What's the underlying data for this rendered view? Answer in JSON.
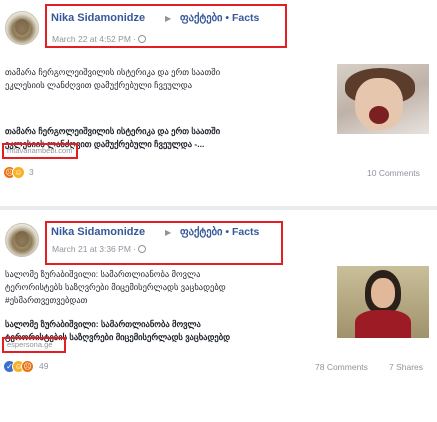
{
  "posts": [
    {
      "author": "Nika Sidamonidze",
      "arrow": "▶",
      "group": "ფაქტები • Facts",
      "time": "March 22 at 4:52 PM ·",
      "text_lines": [
        "თამარა ჩერგოლეიშვილის ისტერიკა და ერთ საათში",
        "ეკლესიის ლანძღვით დამუქრებული ჩვეულდა"
      ],
      "preview_lines": [
        "თამარა ჩერგოლეიშვილის ისტერიკა და ერთ საათში",
        "ეკლესიის ლანძღვით დამუქრებული ჩვეულდა -..."
      ],
      "source": "mtavariambebi.com",
      "reaction_count": "3",
      "comments": "10 Comments",
      "shares": ""
    },
    {
      "author": "Nika Sidamonidze",
      "arrow": "▶",
      "group": "ფაქტები • Facts",
      "time": "March 21 at 3:36 PM ·",
      "text_lines": [
        "სალომე ზურაბიშვილი: სამართლიანობა მოვლა",
        "ტერორისტებს საზღვრები მიცემისერლადს ვაცხადებდ",
        "#ესმართვეთვებდათ"
      ],
      "preview_lines": [
        "სალომე ზურაბიშვილი: სამართლიანობა მოვლა",
        "ტერორისტების საზღვრები მიცემისერლადს ვაცხადებდ"
      ],
      "source": "espersona.ge",
      "reaction_count": "49",
      "comments": "78 Comments",
      "shares": "7 Shares"
    }
  ],
  "colors": {
    "link": "#365899",
    "highlight": "#e31f26",
    "meta": "#90949c"
  }
}
